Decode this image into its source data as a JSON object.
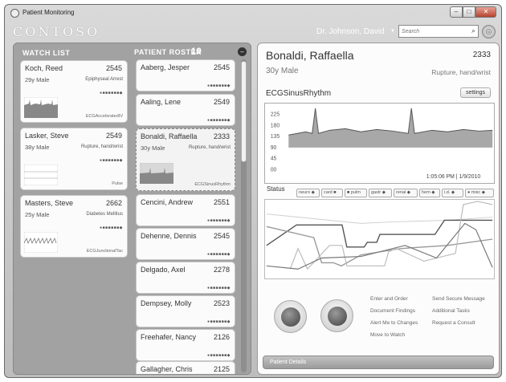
{
  "window": {
    "title": "Patient Monitoring",
    "min_label": "–",
    "max_label": "□",
    "close_label": "✕"
  },
  "header": {
    "brand": "CONTOSO",
    "user": "Dr. Johnson, David",
    "search_placeholder": "Search"
  },
  "icons": {
    "search": "search-icon",
    "app": "app-orb-icon",
    "collapse": "collapse-icon"
  },
  "watch_list": {
    "title": "WATCH LIST",
    "items": [
      {
        "name": "Koch, Reed",
        "id": "2545",
        "demo": "29y Male",
        "diagnosis": "Epiphyseal Arrest",
        "rhythm": "ECGAcceleratedIV",
        "dots": "●■■■■■■◆"
      },
      {
        "name": "Lasker, Steve",
        "id": "2549",
        "demo": "38y Male",
        "diagnosis": "Rupture, hand/wrist",
        "rhythm": "Pulse",
        "dots": "●■■■■■■◆"
      },
      {
        "name": "Masters, Steve",
        "id": "2662",
        "demo": "25y Male",
        "diagnosis": "Diabetes Mellitus",
        "rhythm": "ECGJunctionalTac",
        "dots": "●■■■■■■◆"
      }
    ]
  },
  "roster": {
    "title": "PATIENT ROSTER",
    "count": "19",
    "items": [
      {
        "name": "Aaberg, Jesper",
        "id": "2545",
        "dots": "●■■■■■■◆"
      },
      {
        "name": "Aaling, Lene",
        "id": "2549",
        "dots": "●■■■■■■◆"
      },
      {
        "name": "Bonaldi, Raffaella",
        "id": "2333",
        "demo": "30y Male",
        "diagnosis": "Rupture, hand/wrist",
        "rhythm": "ECGSinusRhythm"
      },
      {
        "name": "Cencini, Andrew",
        "id": "2551",
        "dots": "●■■■■■■◆"
      },
      {
        "name": "Dehenne, Dennis",
        "id": "2545",
        "dots": "●■■■■■■◆"
      },
      {
        "name": "Delgado, Axel",
        "id": "2278",
        "dots": "●■■■■■■◆"
      },
      {
        "name": "Dempsey, Molly",
        "id": "2523",
        "dots": "●■■■■■■◆"
      },
      {
        "name": "Freehafer, Nancy",
        "id": "2126",
        "dots": "●■■■■■■◆"
      },
      {
        "name": "Gallagher, Chris",
        "id": "2125",
        "dots": "●■■■■■■◆"
      }
    ]
  },
  "detail": {
    "name": "Bonaldi,  Raffaella",
    "id": "2333",
    "demo": "30y Male",
    "diagnosis": "Rupture, hand/wrist",
    "rhythm": "ECGSinusRhythm",
    "settings_label": "settings",
    "ecg_timestamp": "1:05:06 PM | 1/9/2010",
    "ecg_ticks": [
      "225",
      "180",
      "135",
      "90",
      "45",
      "00"
    ],
    "status_label": "Status",
    "status_tabs": [
      "neuro",
      "card",
      "pulm",
      "gastr",
      "renal",
      "hem",
      "i.d.",
      "misc"
    ],
    "actions": [
      "Enter and Order",
      "Send Secure Message",
      "Document Findings",
      "Additional Tasks",
      "Alert Me to Changes",
      "Request a Consult",
      "Move to Watch"
    ],
    "details_bar_label": "Patient Details"
  }
}
